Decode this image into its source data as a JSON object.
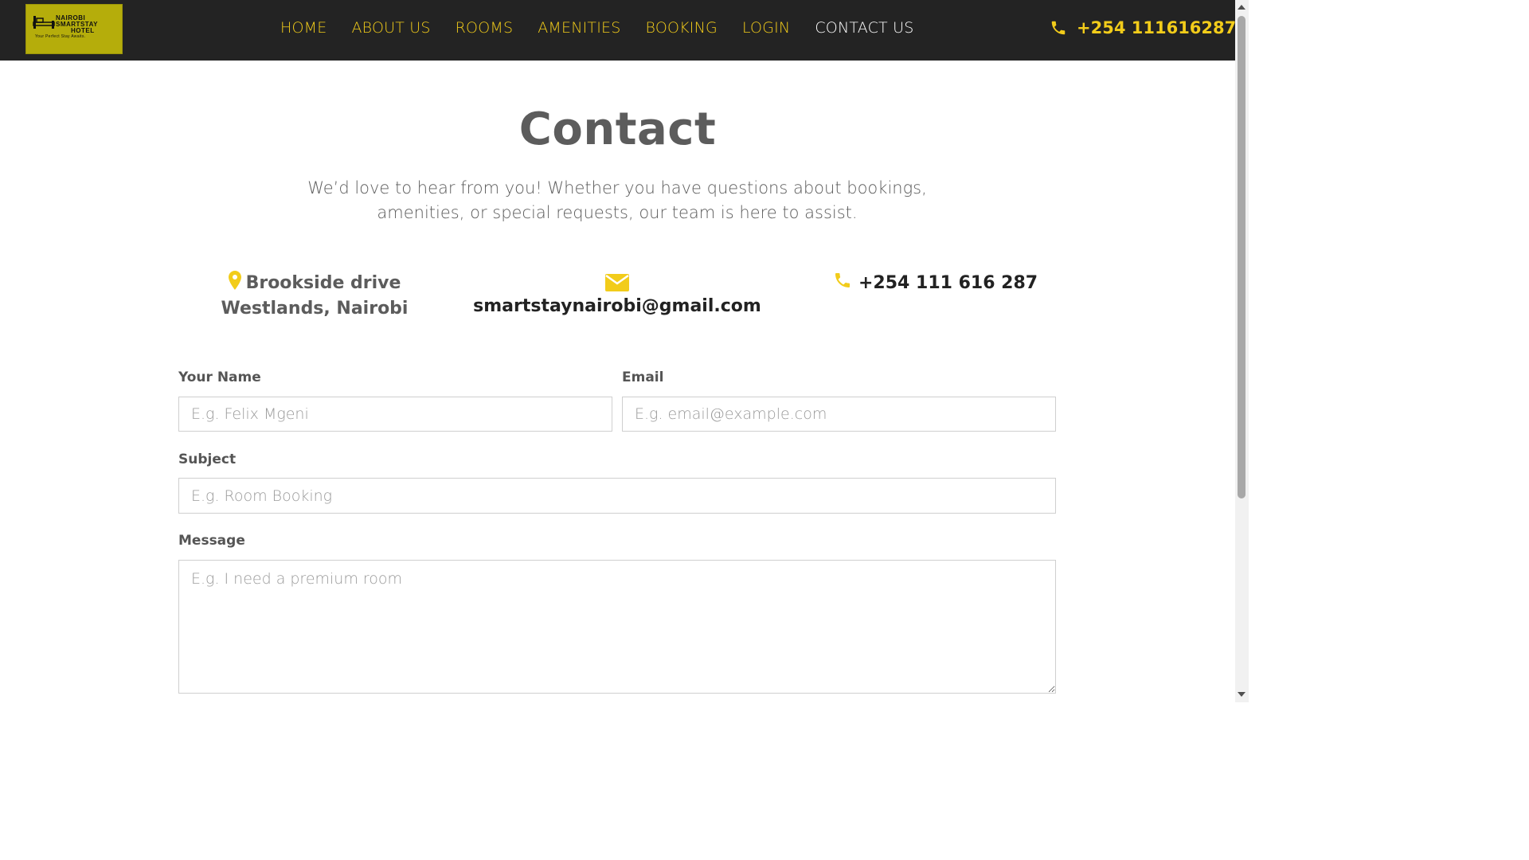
{
  "brand": {
    "logo_line1": "NAIROBI",
    "logo_line2": "SMARTSTAY",
    "logo_line3": "HOTEL",
    "logo_tagline": "Your Perfect Stay Awaits.",
    "accent_color": "#f2cc1a",
    "nav_bg_color": "#232323",
    "logo_bg_color": "#b5ad0b"
  },
  "nav": {
    "items": [
      {
        "label": "HOME"
      },
      {
        "label": "ABOUT US"
      },
      {
        "label": "ROOMS"
      },
      {
        "label": "AMENITIES"
      },
      {
        "label": "BOOKING"
      },
      {
        "label": "LOGIN"
      },
      {
        "label": "CONTACT US",
        "active": true
      }
    ],
    "phone": "+254 111616287",
    "phone_icon": "phone-icon"
  },
  "main": {
    "title": "Contact",
    "intro": "We’d love to hear from you! Whether you have questions about bookings, amenities, or special requests, our team is here to assist.",
    "address_line1": "Brookside drive",
    "address_line2": "Westlands, Nairobi",
    "address_icon": "map-marker-icon",
    "email": "smartstaynairobi@gmail.com",
    "email_icon": "envelope-icon",
    "phone": "+254 111 616 287",
    "phone_icon": "phone-icon"
  },
  "form": {
    "name_label": "Your Name",
    "name_placeholder": "E.g. Felix Mgeni",
    "email_label": "Email",
    "email_placeholder": "E.g. email@example.com",
    "subject_label": "Subject",
    "subject_placeholder": "E.g. Room Booking",
    "message_label": "Message",
    "message_placeholder": "E.g. I need a premium room"
  }
}
